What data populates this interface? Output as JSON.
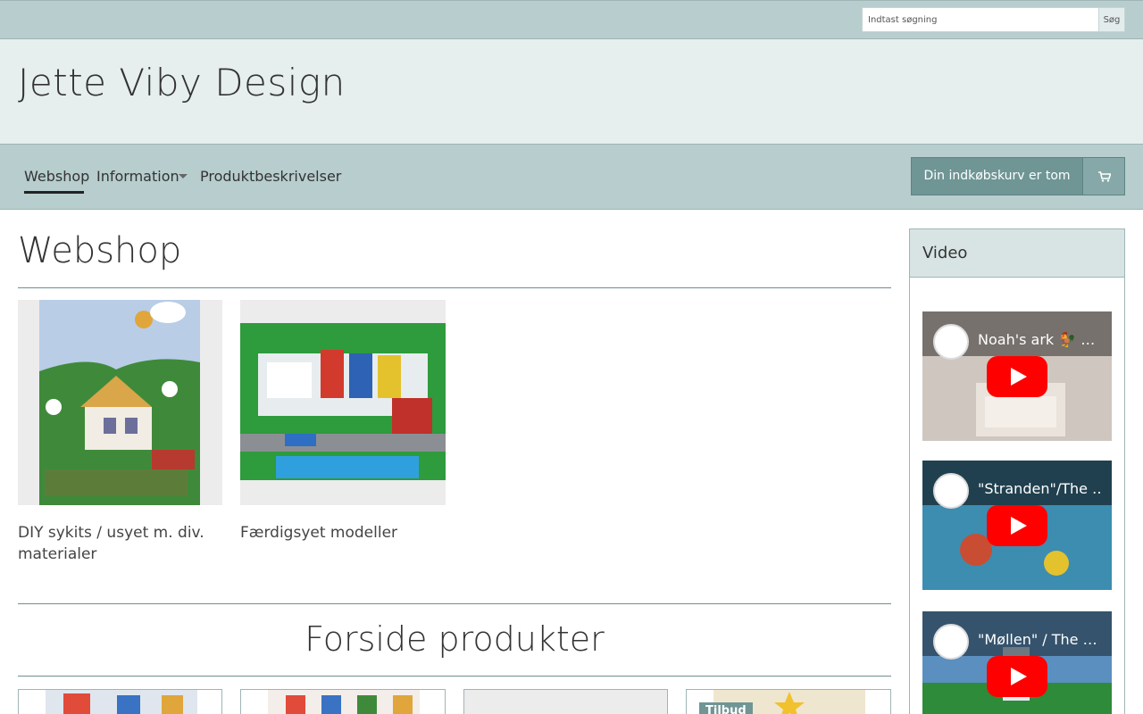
{
  "search": {
    "placeholder": "Indtast søgning",
    "button_label": "Søg"
  },
  "site": {
    "title": "Jette Viby Design"
  },
  "nav": {
    "items": [
      {
        "label": "Webshop",
        "active": true
      },
      {
        "label": "Information",
        "has_dropdown": true
      },
      {
        "label": "Produktbeskrivelser"
      }
    ]
  },
  "cart": {
    "label": "Din indkøbskurv er tom",
    "icon": "shopping-cart-icon"
  },
  "main": {
    "heading": "Webshop",
    "categories": [
      {
        "label": "DIY sykits / usyet m. div. materialer"
      },
      {
        "label": "Færdigsyet modeller"
      }
    ],
    "section_heading": "Forside produkter",
    "offer_badge": "Tilbud"
  },
  "sidebar": {
    "title": "Video",
    "videos": [
      {
        "title": "Noah's ark 🐓 …"
      },
      {
        "title": "\"Stranden\"/The …"
      },
      {
        "title": "\"Møllen\" / The …"
      }
    ]
  },
  "colors": {
    "bar": "#b7cdce",
    "header": "#e6eeee",
    "accent": "#6f9595",
    "play": "#ff0000"
  }
}
